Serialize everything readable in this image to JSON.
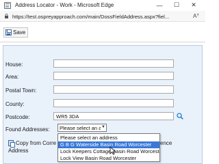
{
  "window": {
    "title": "Address Locator - Work - Microsoft Edge",
    "min_icon": "minimize-icon",
    "max_icon": "maximize-icon",
    "close_icon": "close-icon"
  },
  "address_bar": {
    "url": "https://test.ospreyapproach.com/main/DossFieldAddress.aspx?fiel...",
    "lock_icon": "lock-icon",
    "reader_icon": "Aᵀ"
  },
  "toolbar": {
    "save_label": "Save",
    "save_icon": "floppy-disk-icon"
  },
  "form": {
    "house_label": "House:",
    "house_value": "",
    "area_label": "Area:",
    "area_value": "",
    "postal_town_label": "Postal Town:",
    "postal_town_value": "",
    "county_label": "County:",
    "county_value": "",
    "postcode_label": "Postcode:",
    "postcode_value": "WR5 3DA",
    "found_addresses_label": "Found Addresses:",
    "found_addresses_selected": "Please select an a",
    "copy_label_part1": "Copy from Corre",
    "copy_label_tail": "ence",
    "copy_label_part2": "Address"
  },
  "dropdown": {
    "options": [
      "Please select an address",
      "G B G Waterside Basin Road Worcester",
      "Lock Keepers Cottage Basin Road Worcester",
      "Lock View Basin Road Worcester"
    ],
    "selected_index": 1
  },
  "colors": {
    "panel_bg": "#e9f1fa",
    "panel_border": "#b7cce4",
    "selection": "#3a79d8",
    "search_icon": "#1f7fd1"
  }
}
